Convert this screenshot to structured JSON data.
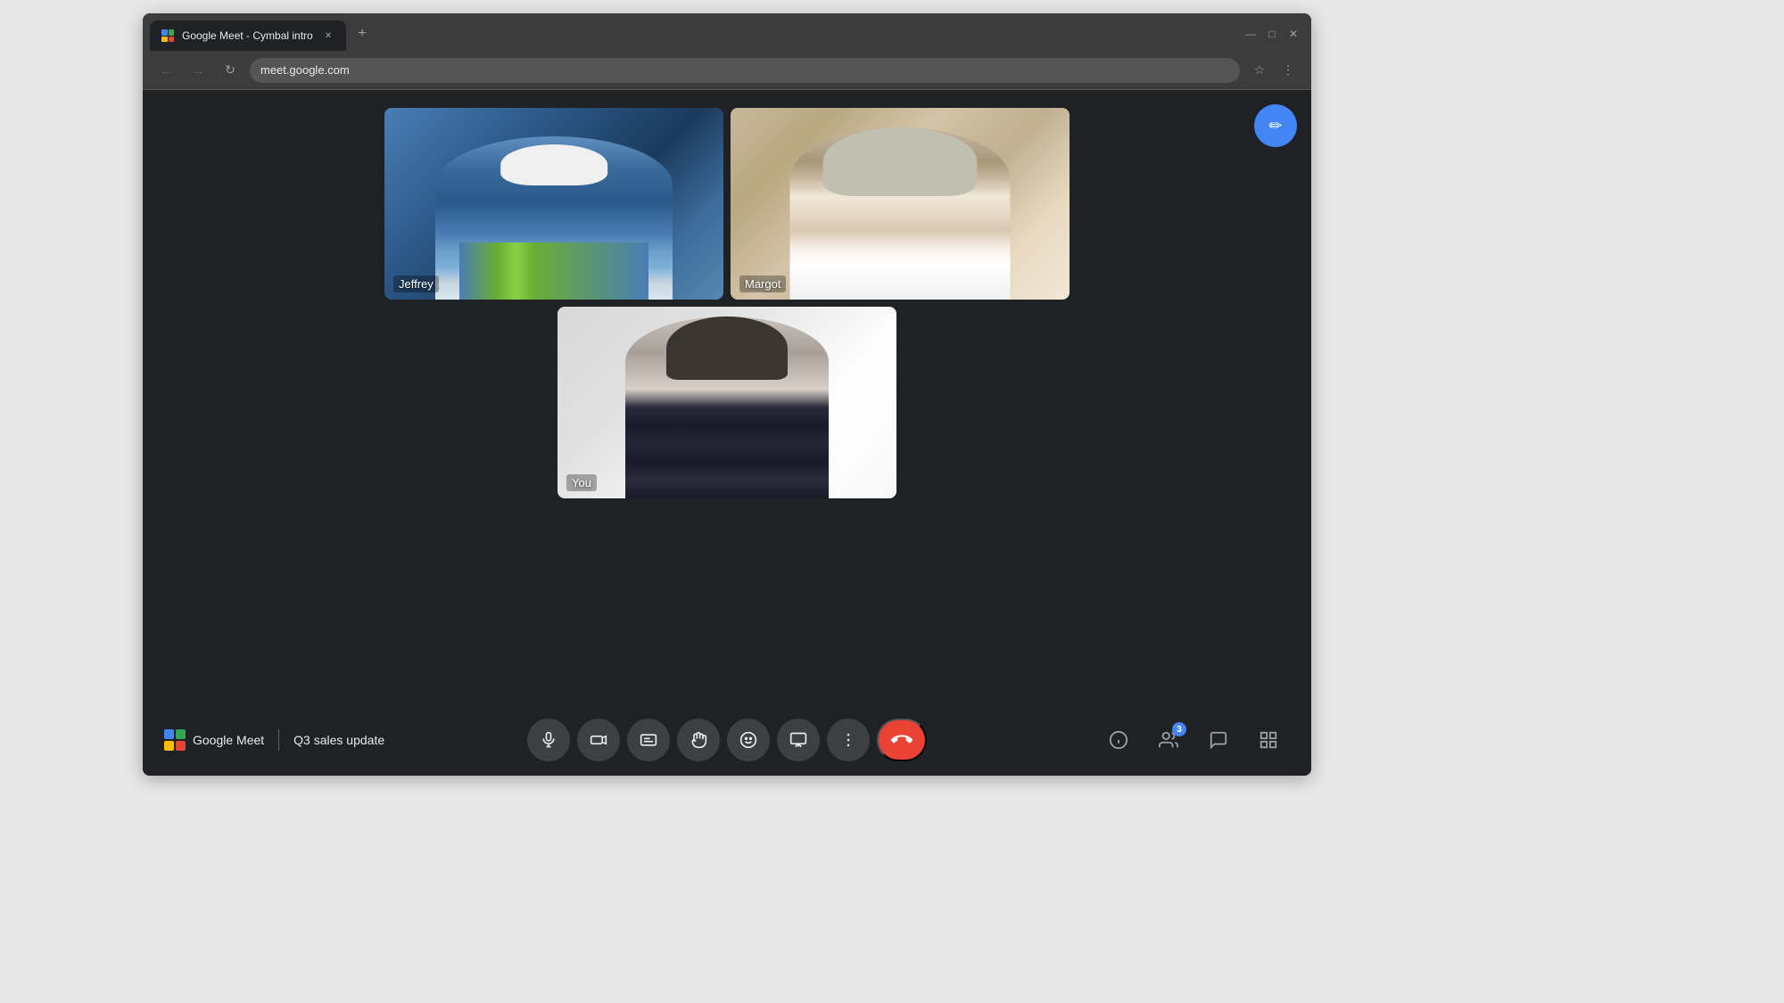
{
  "browser": {
    "tab_title": "Google Meet - Cymbal intro",
    "new_tab_tooltip": "New tab",
    "window_minimize": "—",
    "window_maximize": "□",
    "window_close": "✕",
    "address_url": "meet.google.com",
    "back_disabled": true,
    "forward_disabled": true
  },
  "meet": {
    "logo_text": "Google Meet",
    "meeting_name": "Q3 sales update",
    "edit_btn_label": "✏",
    "participants": [
      {
        "name": "Jeffrey",
        "position": "top-left",
        "video_style": "jeffrey"
      },
      {
        "name": "Margot",
        "position": "top-right",
        "video_style": "margot"
      },
      {
        "name": "You",
        "position": "bottom-center",
        "video_style": "you"
      }
    ],
    "toolbar": {
      "mic_icon": "🎤",
      "camera_icon": "📷",
      "captions_icon": "CC",
      "raise_hand_icon": "✋",
      "emoji_icon": "😊",
      "present_icon": "⬆",
      "more_icon": "⋮",
      "end_call_icon": "📞",
      "info_icon": "ℹ",
      "people_icon": "👥",
      "people_count": "3",
      "chat_icon": "💬",
      "activities_icon": "⋯"
    }
  },
  "icons": {
    "back": "←",
    "forward": "→",
    "refresh": "↻",
    "bookmark": "☆",
    "menu": "⋮",
    "mic": "mic",
    "camera": "cam",
    "captions": "CC",
    "raise_hand": "hand",
    "emoji": "emoji",
    "present": "present",
    "more": "more",
    "end_call": "phone",
    "info": "info",
    "people": "people",
    "chat": "chat",
    "activities": "grid"
  },
  "colors": {
    "accent_blue": "#4285f4",
    "end_call_red": "#ea4335",
    "toolbar_bg": "#202124",
    "btn_bg": "#3c4043",
    "text_light": "#e8eaed"
  }
}
